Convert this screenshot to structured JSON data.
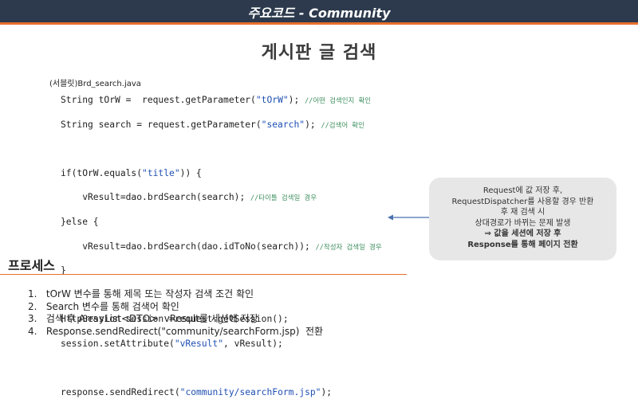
{
  "header": {
    "title": "주요코드 - Community",
    "subtitle": "·"
  },
  "page": {
    "title": "게시판 글 검색"
  },
  "code_block": {
    "file_label": "(서블릿)Brd_search.java",
    "lines": [
      {
        "text": "String tOrW =  request.getParameter(",
        "str": "\"tOrW\"",
        "rest": "); ",
        "comment": "//어떤 검색인지 확인"
      },
      {
        "text": "String search = request.getParameter(",
        "str": "\"search\"",
        "rest": "); ",
        "comment": "//검색어 확인"
      },
      {
        "text": "",
        "str": "",
        "rest": "",
        "comment": ""
      },
      {
        "text": "if(tOrW.equals(",
        "str": "\"title\"",
        "rest": ")) {",
        "comment": ""
      },
      {
        "text": "    vResult=dao.brdSearch(search); ",
        "str": "",
        "rest": "",
        "comment": "//타이틀 검색일 경우"
      },
      {
        "text": "}else {",
        "str": "",
        "rest": "",
        "comment": ""
      },
      {
        "text": "    vResult=dao.brdSearch(dao.idToNo(search)); ",
        "str": "",
        "rest": "",
        "comment": "//작성자 검색일 경우"
      },
      {
        "text": "}",
        "str": "",
        "rest": "",
        "comment": ""
      },
      {
        "text": "",
        "str": "",
        "rest": "",
        "comment": ""
      },
      {
        "text": "HttpSession session =request.getSession();",
        "str": "",
        "rest": "",
        "comment": ""
      },
      {
        "text": "session.setAttribute(",
        "str": "\"vResult\"",
        "rest": ", vResult);",
        "comment": ""
      },
      {
        "text": "",
        "str": "",
        "rest": "",
        "comment": ""
      },
      {
        "text": "response.sendRedirect(",
        "str": "\"community/searchForm.jsp\"",
        "rest": ");",
        "comment": ""
      }
    ]
  },
  "callout": {
    "lines": [
      "Request에 값 저장 후,",
      "RequestDispatcher를 사용할 경우 반환",
      "후 재 검색 시",
      "상대경로가 바뀌는 문제 발생",
      "⇒  값을 세션에 저장 후",
      "Response를 통해 페이지 전환"
    ],
    "arrow_color": "#4a72b0"
  },
  "process": {
    "title": "프로세스",
    "steps": [
      "1.   tOrW 변수를 통해 제목 또는 작성자 검색 조건 확인",
      "2.   Search 변수를 통해 검색어 확인",
      "3.   검색 후 ArrayList<DTO>  vResult를 세션에 저장",
      "4.   Response.sendRedirect(\"community/searchForm.jsp)  전환"
    ]
  },
  "colors": {
    "header_bg": "#2d3a4d",
    "accent": "#e8702a",
    "string": "#1f4fb3",
    "comment": "#3f8f5f"
  }
}
